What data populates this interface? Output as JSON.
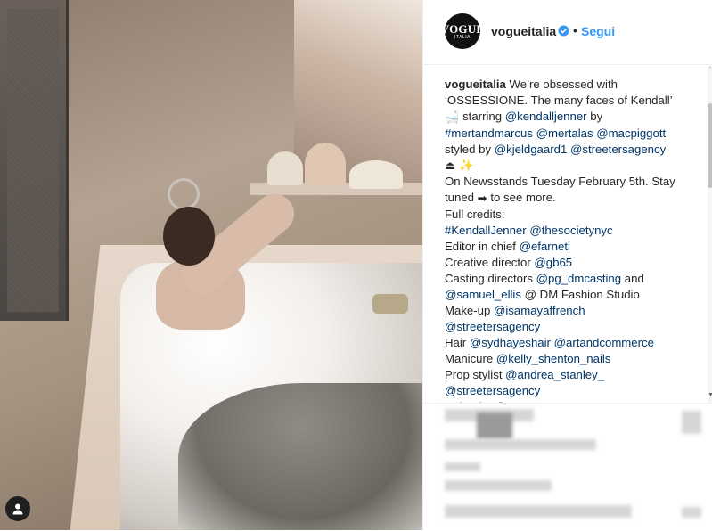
{
  "post": {
    "username": "vogueitalia",
    "follow_label": "Segui",
    "separator": "•",
    "avatar_line1": "VOGUE",
    "avatar_line2": "ITALIA"
  },
  "caption": {
    "lines": [
      {
        "segments": [
          {
            "t": "vogueitalia",
            "k": "u"
          },
          {
            "t": " We’re obsessed with",
            "k": "t"
          }
        ]
      },
      {
        "segments": [
          {
            "t": "‘OSSESSIONE. The many faces of Kendall’",
            "k": "t"
          }
        ]
      },
      {
        "segments": [
          {
            "t": "🛁",
            "k": "e"
          },
          {
            "t": " starring ",
            "k": "t"
          },
          {
            "t": "@kendalljenner",
            "k": "l"
          },
          {
            "t": " by",
            "k": "t"
          }
        ]
      },
      {
        "segments": [
          {
            "t": "#mertandmarcus",
            "k": "l"
          },
          {
            "t": " ",
            "k": "t"
          },
          {
            "t": "@mertalas",
            "k": "l"
          },
          {
            "t": " ",
            "k": "t"
          },
          {
            "t": "@macpiggott",
            "k": "l"
          }
        ]
      },
      {
        "segments": [
          {
            "t": "styled by ",
            "k": "t"
          },
          {
            "t": "@kjeldgaard1",
            "k": "l"
          },
          {
            "t": " ",
            "k": "t"
          },
          {
            "t": "@streetersagency",
            "k": "l"
          }
        ]
      },
      {
        "segments": [
          {
            "t": "⏏",
            "k": "e"
          },
          {
            "t": " ",
            "k": "t"
          },
          {
            "t": "✨",
            "k": "e"
          }
        ]
      },
      {
        "segments": [
          {
            "t": "On Newsstands Tuesday February 5th. Stay",
            "k": "t"
          }
        ]
      },
      {
        "segments": [
          {
            "t": "tuned ",
            "k": "t"
          },
          {
            "t": "➡",
            "k": "e"
          },
          {
            "t": " to see more.",
            "k": "t"
          }
        ]
      },
      {
        "segments": [
          {
            "t": "Full credits:",
            "k": "t"
          }
        ]
      },
      {
        "segments": [
          {
            "t": "#KendallJenner",
            "k": "l"
          },
          {
            "t": " ",
            "k": "t"
          },
          {
            "t": "@thesocietynyc",
            "k": "l"
          }
        ]
      },
      {
        "segments": [
          {
            "t": "Editor in chief ",
            "k": "t"
          },
          {
            "t": "@efarneti",
            "k": "l"
          }
        ]
      },
      {
        "segments": [
          {
            "t": "Creative director ",
            "k": "t"
          },
          {
            "t": "@gb65",
            "k": "l"
          }
        ]
      },
      {
        "segments": [
          {
            "t": "Casting directors ",
            "k": "t"
          },
          {
            "t": "@pg_dmcasting",
            "k": "l"
          },
          {
            "t": " and",
            "k": "t"
          }
        ]
      },
      {
        "segments": [
          {
            "t": "@samuel_ellis",
            "k": "l"
          },
          {
            "t": " @ DM Fashion Studio",
            "k": "t"
          }
        ]
      },
      {
        "segments": [
          {
            "t": "Make-up ",
            "k": "t"
          },
          {
            "t": "@isamayaffrench",
            "k": "l"
          }
        ]
      },
      {
        "segments": [
          {
            "t": "@streetersagency",
            "k": "l"
          }
        ]
      },
      {
        "segments": [
          {
            "t": "Hair ",
            "k": "t"
          },
          {
            "t": "@sydhayeshair",
            "k": "l"
          },
          {
            "t": " ",
            "k": "t"
          },
          {
            "t": "@artandcommerce",
            "k": "l"
          }
        ]
      },
      {
        "segments": [
          {
            "t": "Manicure ",
            "k": "t"
          },
          {
            "t": "@kelly_shenton_nails",
            "k": "l"
          }
        ]
      },
      {
        "segments": [
          {
            "t": "Prop stylist ",
            "k": "t"
          },
          {
            "t": "@andrea_stanley_",
            "k": "l"
          }
        ]
      },
      {
        "segments": [
          {
            "t": "@streetersagency",
            "k": "l"
          }
        ]
      },
      {
        "segments": [
          {
            "t": "Colourist ",
            "k": "t"
          },
          {
            "t": "@...",
            "k": "l"
          }
        ]
      }
    ]
  },
  "colors": {
    "link": "#003569",
    "follow": "#3897f0",
    "verified": "#3897f0",
    "text": "#262626"
  },
  "icons": {
    "verified": "verified-badge-icon",
    "profile_badge": "user-tag-icon"
  }
}
